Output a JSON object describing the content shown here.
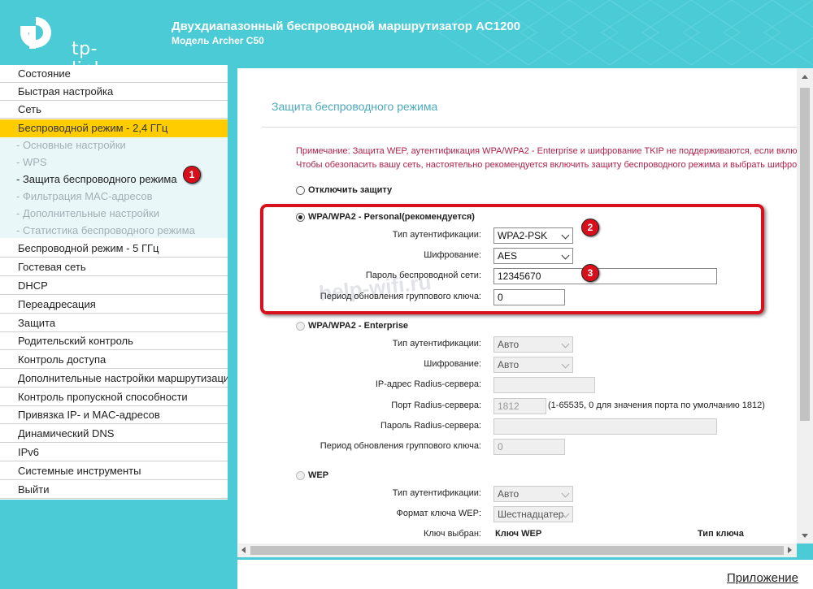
{
  "header": {
    "logo_text": "tp-link",
    "title": "Двухдиапазонный беспроводной маршрутизатор AC1200",
    "model": "Модель Archer C50"
  },
  "colors": {
    "accent": "#4acbd6",
    "active_menu": "#ffcc00",
    "annotation": "#d8101b",
    "note_text": "#b0204a",
    "section_title": "#4aaabb"
  },
  "sidebar": {
    "items_top": [
      "Состояние",
      "Быстрая настройка",
      "Сеть"
    ],
    "active": "Беспроводной режим - 2,4 ГГц",
    "sub_items": [
      "- Основные настройки",
      "- WPS",
      "- Защита беспроводного режима",
      "- Фильтрация MAC-адресов",
      "- Дополнительные настройки",
      "- Статистика беспроводного режима"
    ],
    "items_bottom": [
      "Беспроводной режим - 5 ГГц",
      "Гостевая сеть",
      "DHCP",
      "Переадресация",
      "Защита",
      "Родительский контроль",
      "Контроль доступа",
      "Дополнительные настройки маршрутизации",
      "Контроль пропускной способности",
      "Привязка IP- и MAC-адресов",
      "Динамический DNS",
      "IPv6",
      "Системные инструменты",
      "Выйти"
    ]
  },
  "main": {
    "title": "Защита беспроводного режима",
    "note_line1": "Примечание: Защита WEP, аутентификация WPA/WPA2 - Enterprise и шифрование TKIP не поддерживаются, если включе",
    "note_line2": "Чтобы обезопасить вашу сеть, настоятельно рекомендуется включить защиту беспроводного режима и выбрать шифрова",
    "disable_label": "Отключить защиту",
    "personal": {
      "label": "WPA/WPA2 - Personal(рекомендуется)",
      "auth_label": "Тип аутентификации:",
      "auth_value": "WPA2-PSK",
      "enc_label": "Шифрование:",
      "enc_value": "AES",
      "pass_label": "Пароль беспроводной сети:",
      "pass_value": "12345670",
      "period_label": "Период обновления группового ключа:",
      "period_value": "0"
    },
    "enterprise": {
      "label": "WPA/WPA2 - Enterprise",
      "auth_label": "Тип аутентификации:",
      "auth_value": "Авто",
      "enc_label": "Шифрование:",
      "enc_value": "Авто",
      "radius_ip_label": "IP-адрес Radius-сервера:",
      "radius_port_label": "Порт Radius-сервера:",
      "radius_port_value": "1812",
      "radius_port_hint": "(1-65535, 0 для значения порта по умолчанию 1812)",
      "radius_pass_label": "Пароль Radius-сервера:",
      "period_label": "Период обновления группового ключа:",
      "period_value": "0"
    },
    "wep": {
      "label": "WEP",
      "auth_label": "Тип аутентификации:",
      "auth_value": "Авто",
      "format_label": "Формат ключа WEP:",
      "format_value": "Шестнадцатер",
      "key_selected_label": "Ключ выбран:",
      "col_key": "Ключ WEP",
      "col_type": "Тип ключа"
    },
    "watermark": "help-wifi.ru"
  },
  "annotations": [
    "1",
    "2",
    "3"
  ],
  "footer": {
    "app_link": "Приложение"
  }
}
